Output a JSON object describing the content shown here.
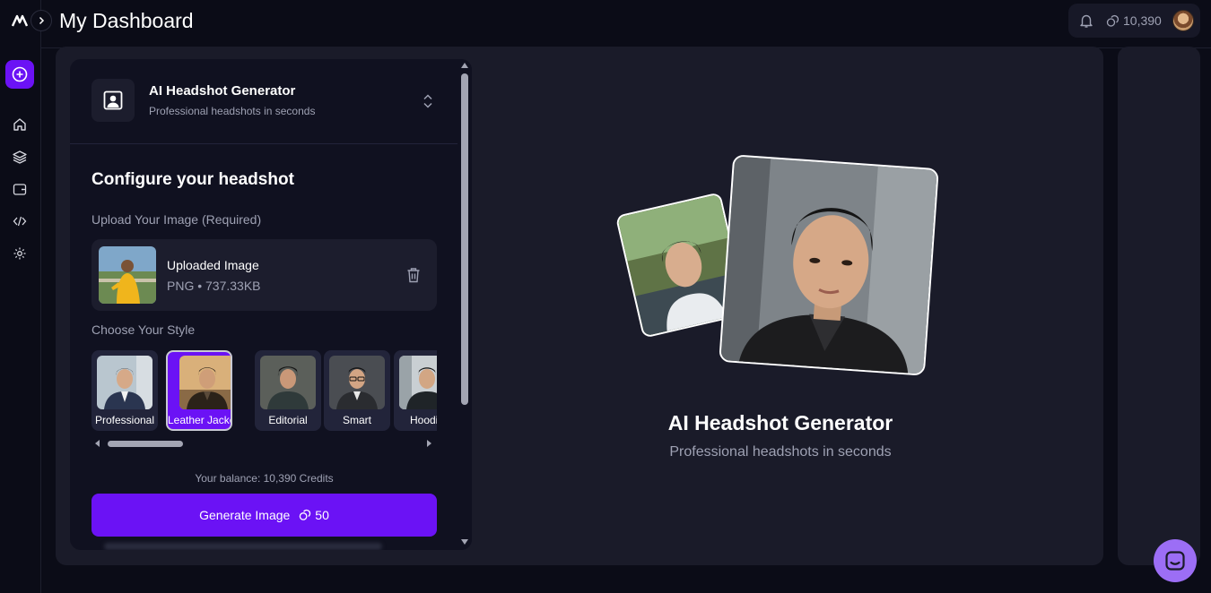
{
  "header": {
    "title": "My Dashboard",
    "credits": "10,390"
  },
  "sidebar": {
    "icons": [
      "app-logo",
      "expand-icon",
      "plus-circle-icon",
      "home-icon",
      "layers-icon",
      "wallet-icon",
      "code-icon",
      "gear-icon"
    ]
  },
  "tool": {
    "title": "AI Headshot Generator",
    "subtitle": "Professional headshots in seconds"
  },
  "config": {
    "title": "Configure your headshot",
    "upload_label": "Upload Your Image (Required)",
    "uploaded_name": "Uploaded Image",
    "uploaded_meta": "PNG • 737.33KB",
    "style_label": "Choose Your Style",
    "styles": [
      {
        "label": "Professional",
        "selected": false
      },
      {
        "label": "Leather Jacket",
        "selected": true
      },
      {
        "label": "Editorial",
        "selected": false
      },
      {
        "label": "Smart",
        "selected": false
      },
      {
        "label": "Hoodie",
        "selected": false
      }
    ],
    "balance": "Your balance: 10,390 Credits",
    "generate_label": "Generate Image",
    "generate_cost": "50"
  },
  "hero": {
    "title": "AI Headshot Generator",
    "subtitle": "Professional headshots in seconds"
  },
  "colors": {
    "accent": "#6b12f5",
    "background": "#0b0c17",
    "card": "#1a1b29",
    "chat": "#9c6ef5"
  }
}
